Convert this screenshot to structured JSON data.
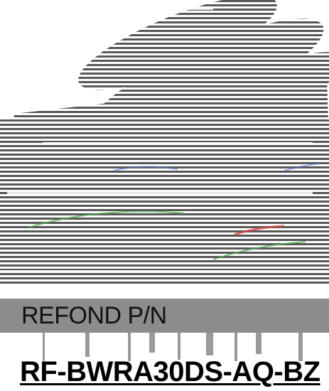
{
  "label": {
    "part_number_caption": "REFOND P/N",
    "part_number_value": "RF-BWRA30DS-AQ-BZ"
  },
  "art": {
    "icon": "product-photo-scanlines",
    "colors": {
      "ink": "#3a3a3a",
      "band": "#8c8c8c",
      "green_accent": "#4caf50",
      "red_accent": "#d64545",
      "blue_accent": "#5a6fd6"
    }
  }
}
